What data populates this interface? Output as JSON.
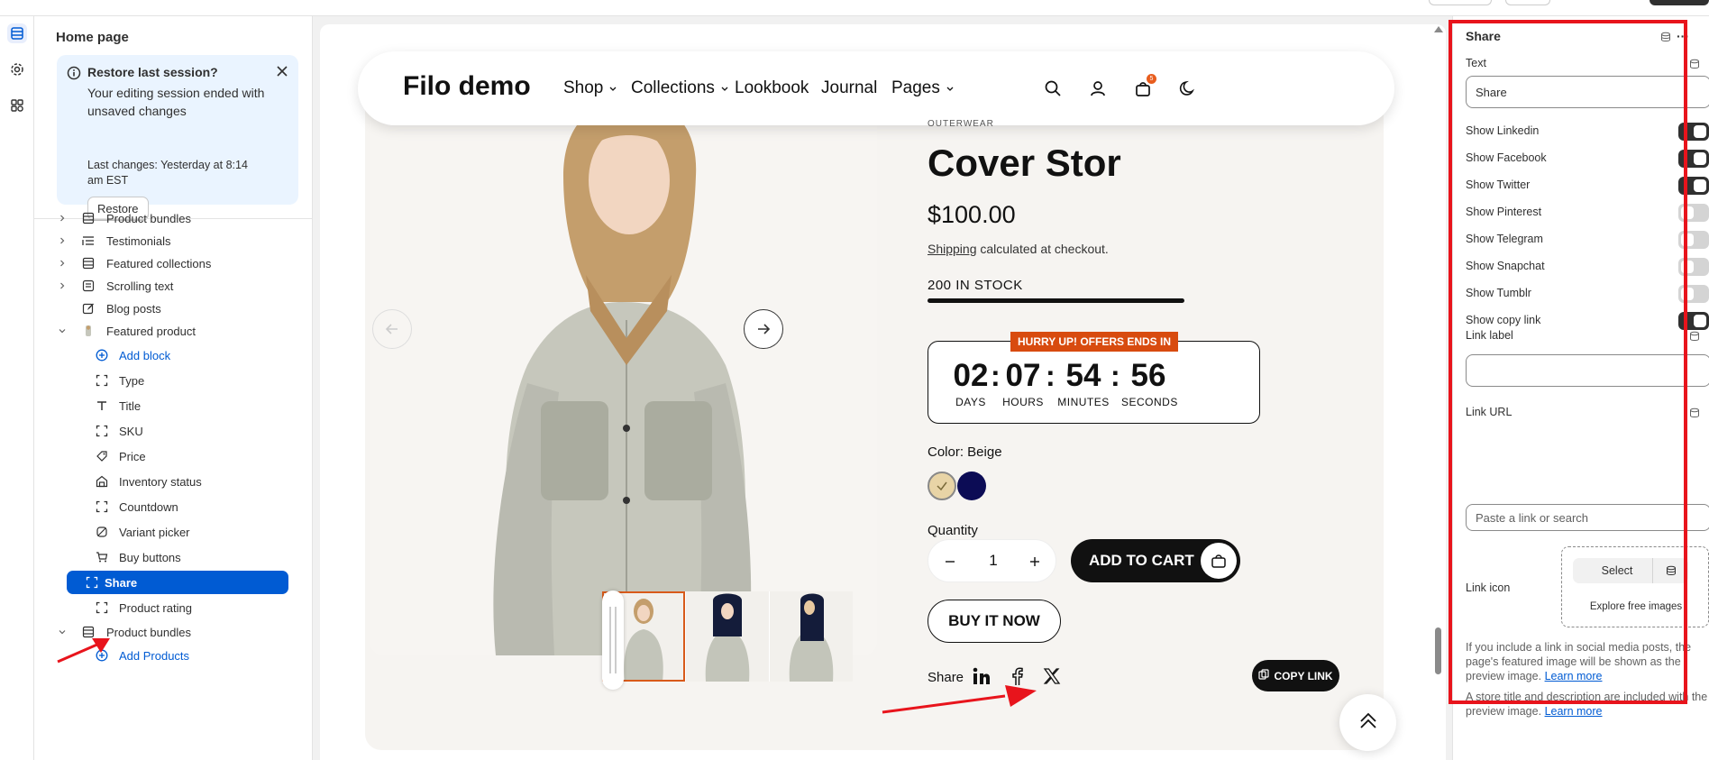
{
  "sidebar": {
    "title": "Home page",
    "banner": {
      "title": "Restore last session?",
      "body": "Your editing session ended with unsaved changes",
      "last_changes": "Last changes: Yesterday at 8:14 am EST",
      "restore_label": "Restore"
    },
    "items": [
      {
        "label": "Product bundles",
        "icon": "section-icon",
        "expandable": true
      },
      {
        "label": "Testimonials",
        "icon": "list-icon",
        "expandable": true
      },
      {
        "label": "Featured collections",
        "icon": "section-icon",
        "expandable": true
      },
      {
        "label": "Scrolling text",
        "icon": "text-section-icon",
        "expandable": true
      },
      {
        "label": "Blog posts",
        "icon": "edit-icon",
        "expandable": false
      },
      {
        "label": "Featured product",
        "icon": "product-thumb-icon",
        "expandable": true,
        "expanded": true
      },
      {
        "label": "Add block",
        "icon": "plus-circle-icon",
        "add": true
      },
      {
        "label": "Type",
        "icon": "block-icon"
      },
      {
        "label": "Title",
        "icon": "text-t-icon"
      },
      {
        "label": "SKU",
        "icon": "block-icon"
      },
      {
        "label": "Price",
        "icon": "price-tag-icon"
      },
      {
        "label": "Inventory status",
        "icon": "inventory-icon"
      },
      {
        "label": "Countdown",
        "icon": "block-icon"
      },
      {
        "label": "Variant picker",
        "icon": "variant-icon"
      },
      {
        "label": "Buy buttons",
        "icon": "cart-icon"
      },
      {
        "label": "Share",
        "icon": "block-icon",
        "selected": true
      },
      {
        "label": "Product rating",
        "icon": "block-icon"
      },
      {
        "label": "Product bundles",
        "icon": "section-icon",
        "expandable": true,
        "expanded": true
      },
      {
        "label": "Add Products",
        "icon": "plus-circle-icon",
        "add": true
      }
    ]
  },
  "storefront": {
    "logo": "Filo demo",
    "nav": [
      {
        "label": "Shop",
        "dropdown": true
      },
      {
        "label": "Collections",
        "dropdown": true
      },
      {
        "label": "Lookbook",
        "dropdown": false
      },
      {
        "label": "Journal",
        "dropdown": false
      },
      {
        "label": "Pages",
        "dropdown": true
      }
    ],
    "cart_count": "5",
    "product": {
      "vendor": "OUTERWEAR",
      "title": "Cover Stor",
      "price": "$100.00",
      "shipping_link": "Shipping",
      "shipping_rest": " calculated at checkout.",
      "stock": "200 IN STOCK",
      "countdown": {
        "tag": "HURRY UP! OFFERS ENDS IN",
        "units": [
          {
            "value": "02",
            "label": "DAYS"
          },
          {
            "value": "07",
            "label": "HOURS"
          },
          {
            "value": "54",
            "label": "MINUTES"
          },
          {
            "value": "56",
            "label": "SECONDS"
          }
        ]
      },
      "color_label": "Color: Beige",
      "colors": [
        "#e8d4a6",
        "#0c0c55"
      ],
      "quantity_label": "Quantity",
      "quantity": "1",
      "add_to_cart": "ADD TO CART",
      "buy_now": "BUY IT NOW",
      "share_label": "Share",
      "share_icons": [
        "linkedin-icon",
        "facebook-icon",
        "x-twitter-icon"
      ],
      "copy_link": "COPY LINK"
    }
  },
  "panel": {
    "title": "Share",
    "text_label": "Text",
    "text_value": "Share",
    "toggles": [
      {
        "label": "Show Linkedin",
        "on": true
      },
      {
        "label": "Show Facebook",
        "on": true
      },
      {
        "label": "Show Twitter",
        "on": true
      },
      {
        "label": "Show Pinterest",
        "on": false
      },
      {
        "label": "Show Telegram",
        "on": false
      },
      {
        "label": "Show Snapchat",
        "on": false
      },
      {
        "label": "Show Tumblr",
        "on": false
      },
      {
        "label": "Show copy link",
        "on": true
      }
    ],
    "link_label_label": "Link label",
    "link_label_value": "",
    "link_url_label": "Link URL",
    "link_url_placeholder": "Paste a link or search",
    "link_icon_label": "Link icon",
    "select_label": "Select",
    "explore_label": "Explore free images",
    "note1": "If you include a link in social media posts, the page's featured image will be shown as the preview image.",
    "note1_link": "Learn more",
    "note2": "A store title and description are included with the preview image.",
    "note2_link": "Learn more"
  },
  "colors": {
    "accent": "#005bd3",
    "annotation": "#e8141c",
    "countdown_tag": "#d84b0f"
  }
}
